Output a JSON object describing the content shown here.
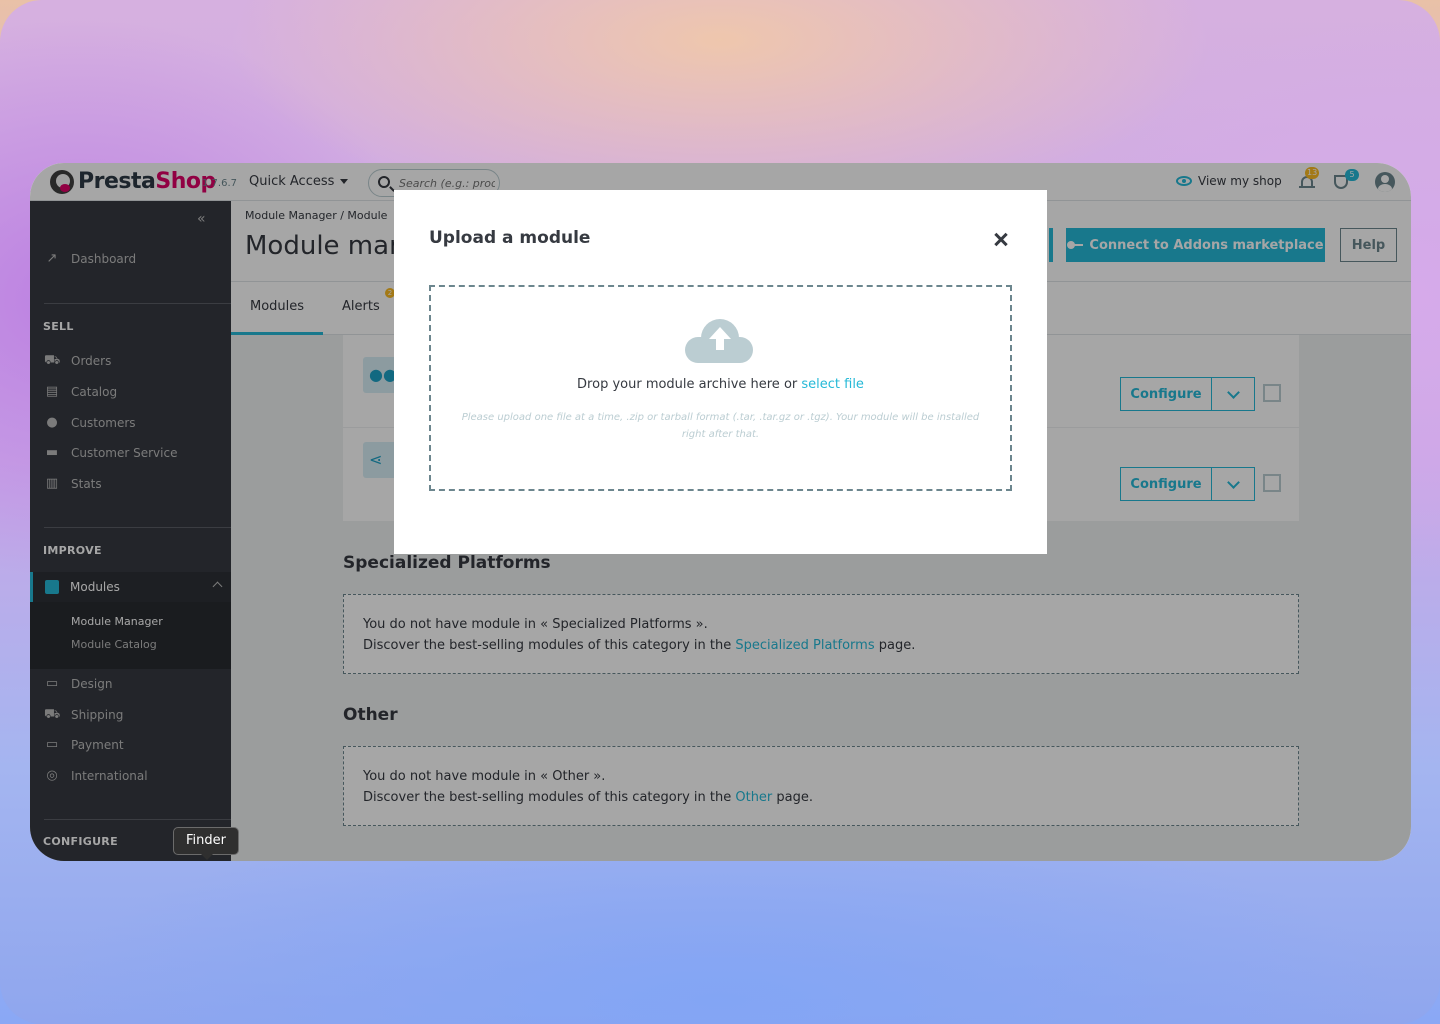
{
  "header": {
    "logo_text_brand": "Presta",
    "logo_text_shop": "Shop",
    "version": "1.7.6.7",
    "quick_access": "Quick Access",
    "search_placeholder": "Search (e.g.: produ",
    "view_shop": "View my shop",
    "notifications_count": "13",
    "trophy_count": "5"
  },
  "sidebar": {
    "dashboard": "Dashboard",
    "sell_section": "SELL",
    "sell_items": [
      "Orders",
      "Catalog",
      "Customers",
      "Customer Service",
      "Stats"
    ],
    "improve_section": "IMPROVE",
    "modules": "Modules",
    "module_submenu": [
      "Module Manager",
      "Module Catalog"
    ],
    "improve_items": [
      "Design",
      "Shipping",
      "Payment",
      "International"
    ],
    "configure_section": "CONFIGURE"
  },
  "page": {
    "breadcrumb": "Module Manager /  Module",
    "title": "Module man",
    "connect_button": "Connect to Addons marketplace",
    "help_button": "Help",
    "tabs": [
      "Modules",
      "Alerts"
    ],
    "alerts_badge": "2"
  },
  "modules_list": {
    "configure_label": "Configure"
  },
  "sections": [
    {
      "title": "Specialized Platforms",
      "line1": "You do not have module in « Specialized Platforms ».",
      "line2_prefix": "Discover the best-selling modules of this category in the ",
      "link": "Specialized Platforms",
      "line2_suffix": " page."
    },
    {
      "title": "Other",
      "line1": "You do not have module in « Other ».",
      "line2_prefix": "Discover the best-selling modules of this category in the ",
      "link": "Other",
      "line2_suffix": " page."
    }
  ],
  "modal": {
    "title": "Upload a module",
    "drop_text": "Drop your module archive here or ",
    "select_file": "select file",
    "help_text": "Please upload one file at a time, .zip or tarball format (.tar, .tar.gz or .tgz). Your module will be installed right after that."
  },
  "tooltip": "Finder",
  "colors": {
    "accent": "#25b9d7",
    "brand": "#df0067",
    "sidebar": "#363a41"
  }
}
